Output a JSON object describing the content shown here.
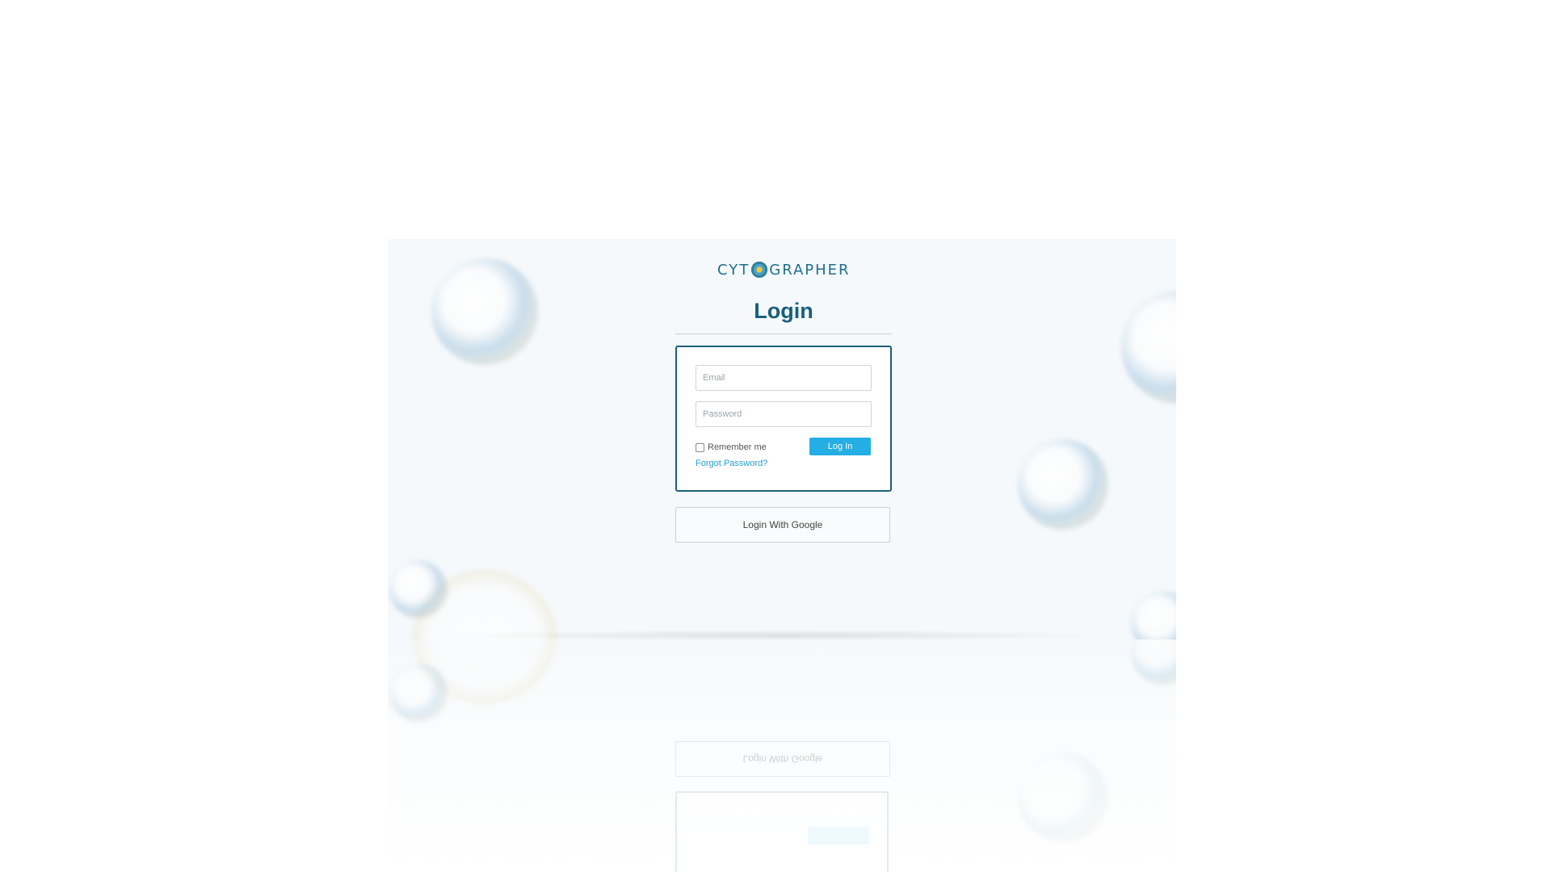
{
  "brand": {
    "logo_left": "CYT",
    "logo_right": "GRAPHER"
  },
  "login": {
    "title": "Login",
    "email_placeholder": "Email",
    "password_placeholder": "Password",
    "remember_label": "Remember me",
    "login_button": "Log In",
    "forgot_link": "Forgot Password?",
    "google_button": "Login With Google"
  },
  "colors": {
    "brand": "#175f7f",
    "accent": "#25aee3",
    "box_border": "#1b5f7a"
  },
  "icons": {
    "logo_mark": "cell-logo-icon"
  }
}
